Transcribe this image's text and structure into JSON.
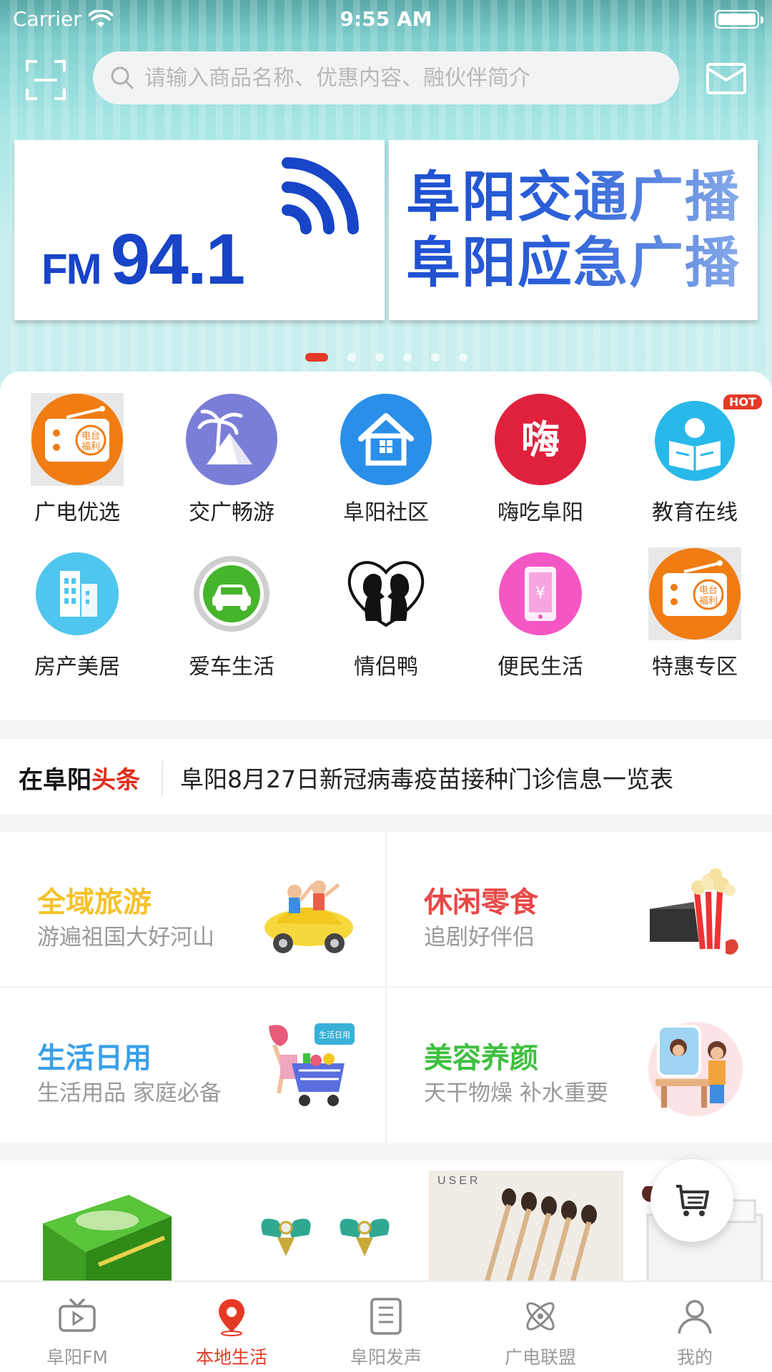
{
  "status_bar": {
    "carrier": "Carrier",
    "time": "9:55 AM"
  },
  "search": {
    "placeholder": "请输入商品名称、优惠内容、融伙伴简介"
  },
  "banner": {
    "left_prefix": "FM",
    "left_number": "94.1",
    "right_line1": "阜阳交通广播",
    "right_line2": "阜阳应急广播",
    "page_count": 6,
    "active_page": 1
  },
  "grid": [
    {
      "label": "广电优选",
      "icon": "radio-icon"
    },
    {
      "label": "交广畅游",
      "icon": "palm-mountain-icon"
    },
    {
      "label": "阜阳社区",
      "icon": "house-icon"
    },
    {
      "label": "嗨吃阜阳",
      "icon": "food-icon"
    },
    {
      "label": "教育在线",
      "icon": "reading-icon",
      "badge": "HOT"
    },
    {
      "label": "房产美居",
      "icon": "building-icon"
    },
    {
      "label": "爱车生活",
      "icon": "car-icon"
    },
    {
      "label": "情侣鸭",
      "icon": "couple-heart-icon"
    },
    {
      "label": "便民生活",
      "icon": "phone-pay-icon"
    },
    {
      "label": "特惠专区",
      "icon": "radio-icon"
    }
  ],
  "news": {
    "logo_part1": "在阜阳",
    "logo_part2": "头条",
    "headline": "阜阳8月27日新冠病毒疫苗接种门诊信息一览表"
  },
  "categories": [
    {
      "title": "全域旅游",
      "subtitle": "游遍祖国大好河山",
      "color": "#f5c22b",
      "art": "travel-car-icon"
    },
    {
      "title": "休闲零食",
      "subtitle": "追剧好伴侣",
      "color": "#e84848",
      "art": "popcorn-icon"
    },
    {
      "title": "生活日用",
      "subtitle": "生活用品 家庭必备",
      "color": "#3aa0e8",
      "art": "shopping-cart-icon"
    },
    {
      "title": "美容养颜",
      "subtitle": "天干物燥 补水重要",
      "color": "#3fc03f",
      "art": "mirror-woman-icon"
    }
  ],
  "products": {
    "brush_tag": "USER"
  },
  "tabs": [
    {
      "label": "阜阳FM",
      "icon": "tv-play-icon",
      "active": false
    },
    {
      "label": "本地生活",
      "icon": "location-pin-icon",
      "active": true
    },
    {
      "label": "阜阳发声",
      "icon": "document-list-icon",
      "active": false
    },
    {
      "label": "广电联盟",
      "icon": "atom-icon",
      "active": false
    },
    {
      "label": "我的",
      "icon": "user-icon",
      "active": false
    }
  ],
  "colors": {
    "accent": "#e53a26",
    "banner_blue": "#1844c7",
    "teal": "#a6e6e4"
  }
}
